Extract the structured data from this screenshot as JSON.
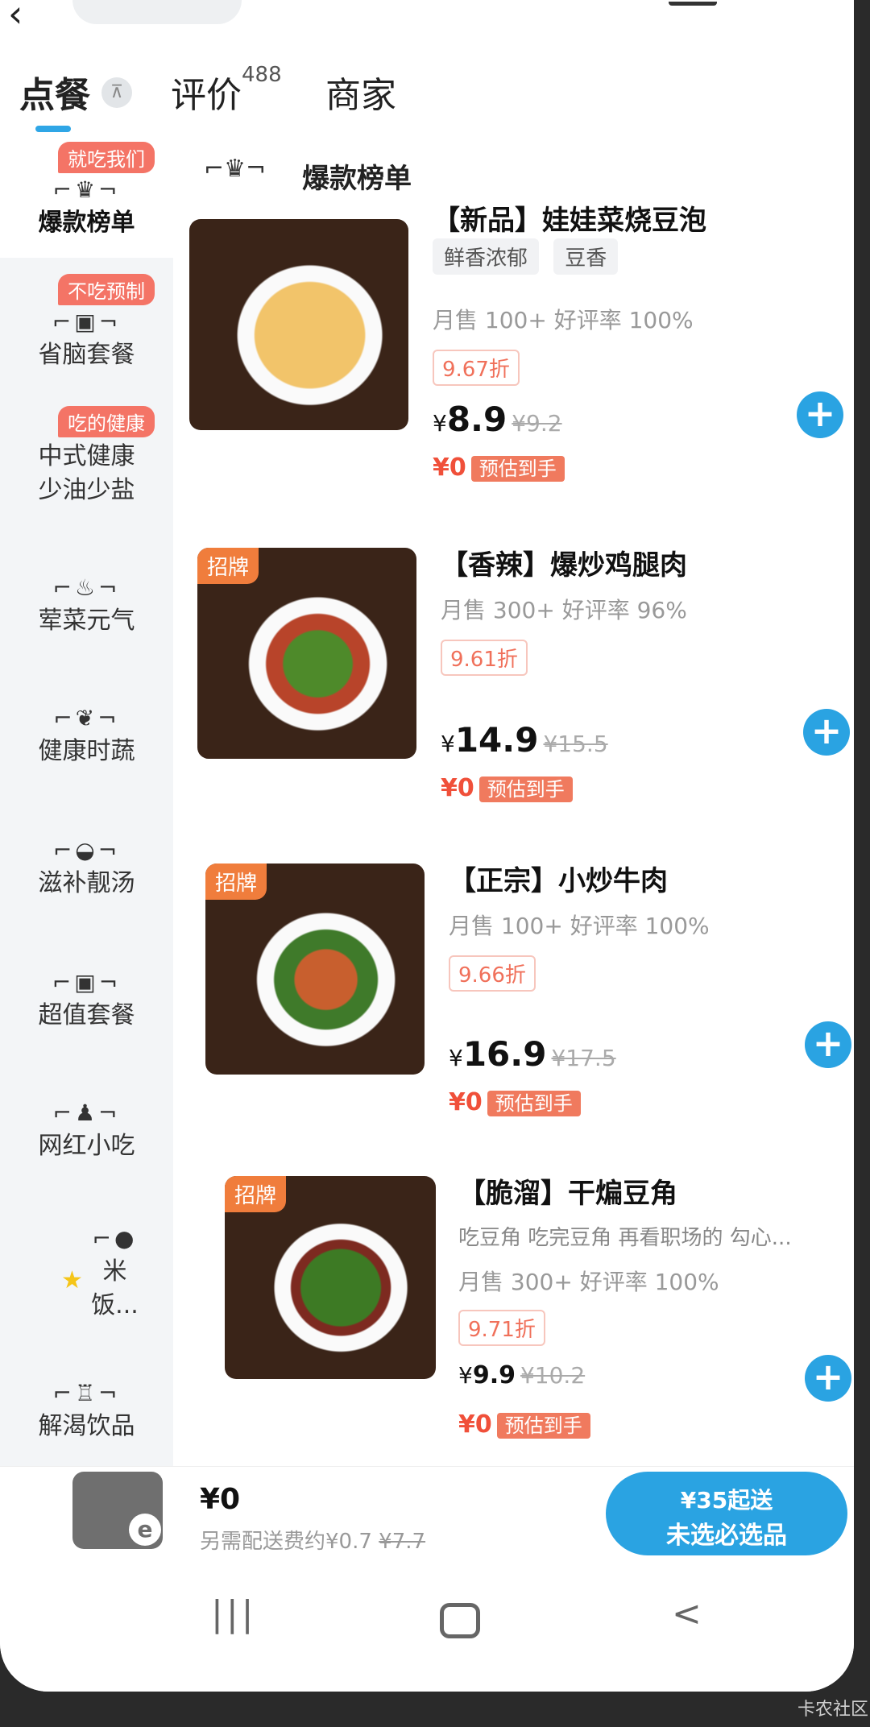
{
  "tabs": {
    "order": "点餐",
    "review": "评价",
    "review_count": "488",
    "shop": "商家"
  },
  "sidebar": {
    "items": [
      {
        "label": "爆款榜单",
        "badge": "就吃我们",
        "icon": "crown-icon"
      },
      {
        "label": "省脑套餐",
        "badge": "不吃预制",
        "icon": "meal-box-icon"
      },
      {
        "label": "中式健康少油少盐",
        "line1": "中式健康",
        "line2": "少油少盐",
        "badge": "吃的健康"
      },
      {
        "label": "荤菜元气",
        "icon": "meat-icon"
      },
      {
        "label": "健康时蔬",
        "icon": "vegetable-icon"
      },
      {
        "label": "滋补靓汤",
        "icon": "soup-icon"
      },
      {
        "label": "超值套餐",
        "icon": "combo-icon"
      },
      {
        "label": "网红小吃",
        "icon": "drumstick-icon"
      },
      {
        "label": "米饭...",
        "line1": "米",
        "line2": "饭...",
        "icon": "rice-icon",
        "star_icon": "star-icon"
      },
      {
        "label": "解渴饮品",
        "icon": "drink-icon"
      }
    ]
  },
  "section": {
    "title": "爆款榜单",
    "icon": "crown-icon"
  },
  "items": [
    {
      "name": "【新品】娃娃菜烧豆泡",
      "tags": [
        "鲜香浓郁",
        "豆香"
      ],
      "sales": "月售 100+ 好评率 100%",
      "discount": "9.67折",
      "price_currency": "¥",
      "price": "8.9",
      "original_price": "¥9.2",
      "estimate_amount": "¥0",
      "estimate_label": "预估到手"
    },
    {
      "badge": "招牌",
      "name": "【香辣】爆炒鸡腿肉",
      "sales": "月售 300+ 好评率 96%",
      "discount": "9.61折",
      "price_currency": "¥",
      "price": "14.9",
      "original_price": "¥15.5",
      "estimate_amount": "¥0",
      "estimate_label": "预估到手"
    },
    {
      "badge": "招牌",
      "name": "【正宗】小炒牛肉",
      "sales": "月售 100+ 好评率 100%",
      "discount": "9.66折",
      "price_currency": "¥",
      "price": "16.9",
      "original_price": "¥17.5",
      "estimate_amount": "¥0",
      "estimate_label": "预估到手"
    },
    {
      "badge": "招牌",
      "name": "【脆溜】干煸豆角",
      "desc": "吃豆角 吃完豆角 再看职场的 勾心...",
      "sales": "月售 300+ 好评率 100%",
      "discount": "9.71折",
      "price_currency": "¥",
      "price": "9.9",
      "original_price": "¥10.2",
      "estimate_amount": "¥0",
      "estimate_label": "预估到手"
    }
  ],
  "cart": {
    "total": "¥0",
    "fee_prefix": "另需配送费约¥0.7",
    "fee_original": "¥7.7",
    "checkout_line1": "¥35起送",
    "checkout_line2": "未选必选品"
  },
  "nav": {
    "recent": "|||",
    "back": "<"
  },
  "watermark": "卡农社区",
  "colors": {
    "accent": "#2aa3e2",
    "badge": "#f47466",
    "price_red": "#f0503a",
    "signature_tag": "#f07d3c"
  }
}
